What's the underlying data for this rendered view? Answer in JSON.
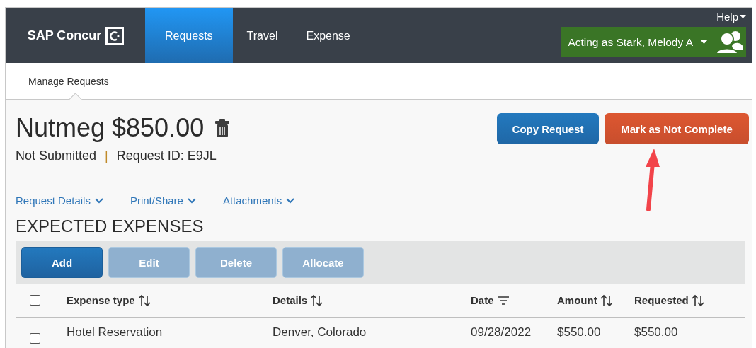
{
  "nav": {
    "logo": "SAP Concur",
    "tabs": [
      {
        "label": "Requests",
        "selected": true
      },
      {
        "label": "Travel",
        "selected": false
      },
      {
        "label": "Expense",
        "selected": false
      }
    ],
    "help": "Help",
    "acting_as": "Acting as Stark, Melody A"
  },
  "subnav": {
    "items": [
      {
        "label": "Manage Requests",
        "selected": true
      }
    ]
  },
  "request": {
    "title": "Nutmeg $850.00",
    "status": "Not Submitted",
    "separator": "|",
    "request_id": "Request ID: E9JL"
  },
  "actions": [
    {
      "label": "Copy Request",
      "kind": "primary"
    },
    {
      "label": "Mark as Not Complete",
      "kind": "danger"
    }
  ],
  "menus": [
    {
      "label": "Request Details"
    },
    {
      "label": "Print/Share"
    },
    {
      "label": "Attachments"
    }
  ],
  "section_title": "EXPECTED EXPENSES",
  "toolbar": [
    {
      "label": "Add",
      "disabled": false
    },
    {
      "label": "Edit",
      "disabled": true
    },
    {
      "label": "Delete",
      "disabled": true
    },
    {
      "label": "Allocate",
      "disabled": true
    }
  ],
  "table": {
    "select_all": {
      "checked": false
    },
    "columns": [
      {
        "label": "Expense type",
        "kind": "sortable"
      },
      {
        "label": "Details",
        "kind": "sortable"
      },
      {
        "label": "Date",
        "kind": "filterable"
      },
      {
        "label": "Amount",
        "kind": "sortable"
      },
      {
        "label": "Requested",
        "kind": "sortable"
      }
    ],
    "rows": [
      {
        "checked": false,
        "cells": [
          "Hotel Reservation",
          "Denver, Colorado",
          "09/28/2022",
          "$550.00",
          "$550.00"
        ]
      }
    ]
  }
}
